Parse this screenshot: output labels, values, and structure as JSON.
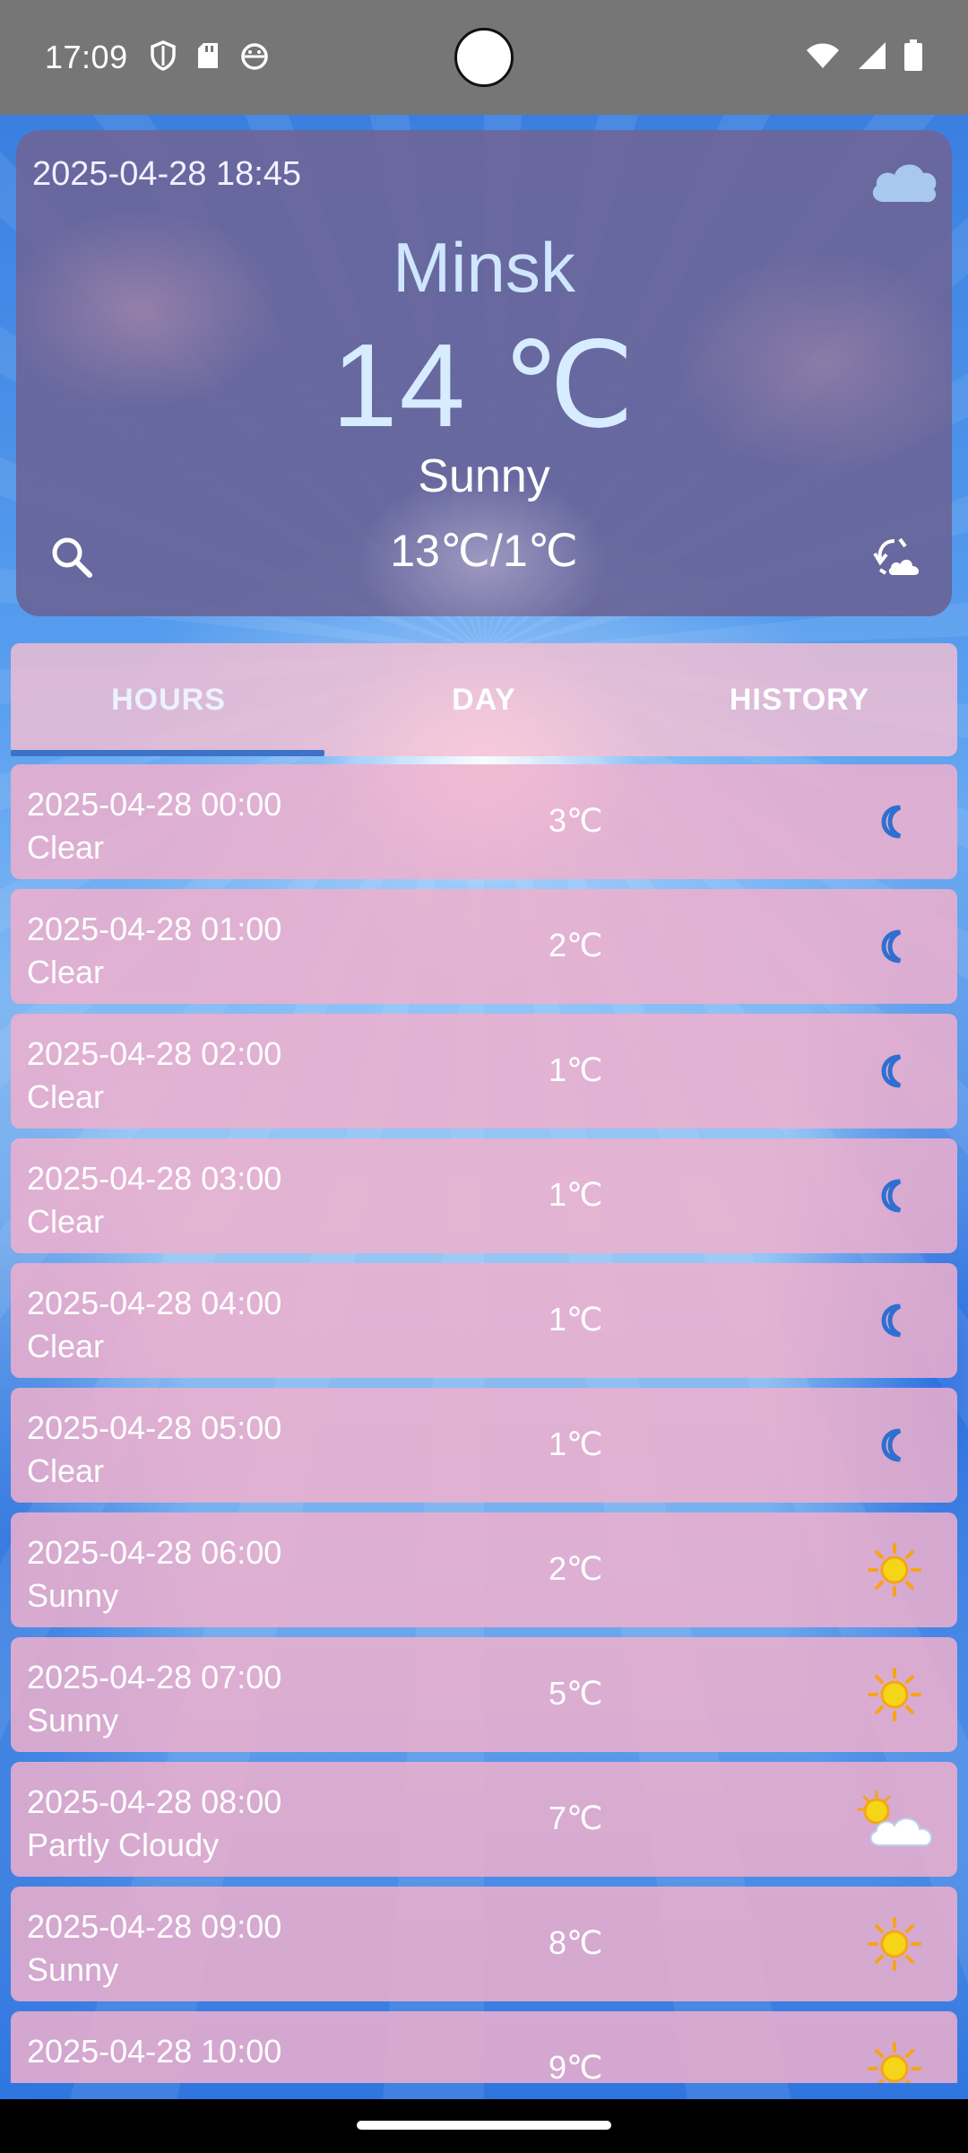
{
  "status_bar": {
    "time": "17:09",
    "left_icons": [
      "shield-icon",
      "sd-card-icon",
      "android-debug-icon"
    ],
    "right_icons": [
      "wifi-icon",
      "signal-icon",
      "battery-icon"
    ]
  },
  "header": {
    "datetime": "2025-04-28 18:45",
    "city": "Minsk",
    "temperature": "14 ℃",
    "condition": "Sunny",
    "min_max": "13℃/1℃",
    "top_right_icon": "cloud-icon",
    "search_icon": "search-icon",
    "refresh_icon": "refresh-weather-icon"
  },
  "tabs": [
    {
      "label": "HOURS",
      "active": true
    },
    {
      "label": "DAY",
      "active": false
    },
    {
      "label": "HISTORY",
      "active": false
    }
  ],
  "hours": [
    {
      "time": "2025-04-28 00:00",
      "condition": "Clear",
      "temp": "3℃",
      "icon": "moon-icon"
    },
    {
      "time": "2025-04-28 01:00",
      "condition": "Clear",
      "temp": "2℃",
      "icon": "moon-icon"
    },
    {
      "time": "2025-04-28 02:00",
      "condition": "Clear",
      "temp": "1℃",
      "icon": "moon-icon"
    },
    {
      "time": "2025-04-28 03:00",
      "condition": "Clear",
      "temp": "1℃",
      "icon": "moon-icon"
    },
    {
      "time": "2025-04-28 04:00",
      "condition": "Clear",
      "temp": "1℃",
      "icon": "moon-icon"
    },
    {
      "time": "2025-04-28 05:00",
      "condition": "Clear",
      "temp": "1℃",
      "icon": "moon-icon"
    },
    {
      "time": "2025-04-28 06:00",
      "condition": "Sunny",
      "temp": "2℃",
      "icon": "sun-icon"
    },
    {
      "time": "2025-04-28 07:00",
      "condition": "Sunny",
      "temp": "5℃",
      "icon": "sun-icon"
    },
    {
      "time": "2025-04-28 08:00",
      "condition": "Partly Cloudy",
      "temp": "7℃",
      "icon": "partly-cloudy-icon"
    },
    {
      "time": "2025-04-28 09:00",
      "condition": "Sunny",
      "temp": "8℃",
      "icon": "sun-icon"
    },
    {
      "time": "2025-04-28 10:00",
      "condition": "",
      "temp": "9℃",
      "icon": "sun-icon"
    }
  ],
  "colors": {
    "moon": "#2f6fd0",
    "sun": "#f5c518",
    "tab_indicator": "#3c72c8"
  }
}
